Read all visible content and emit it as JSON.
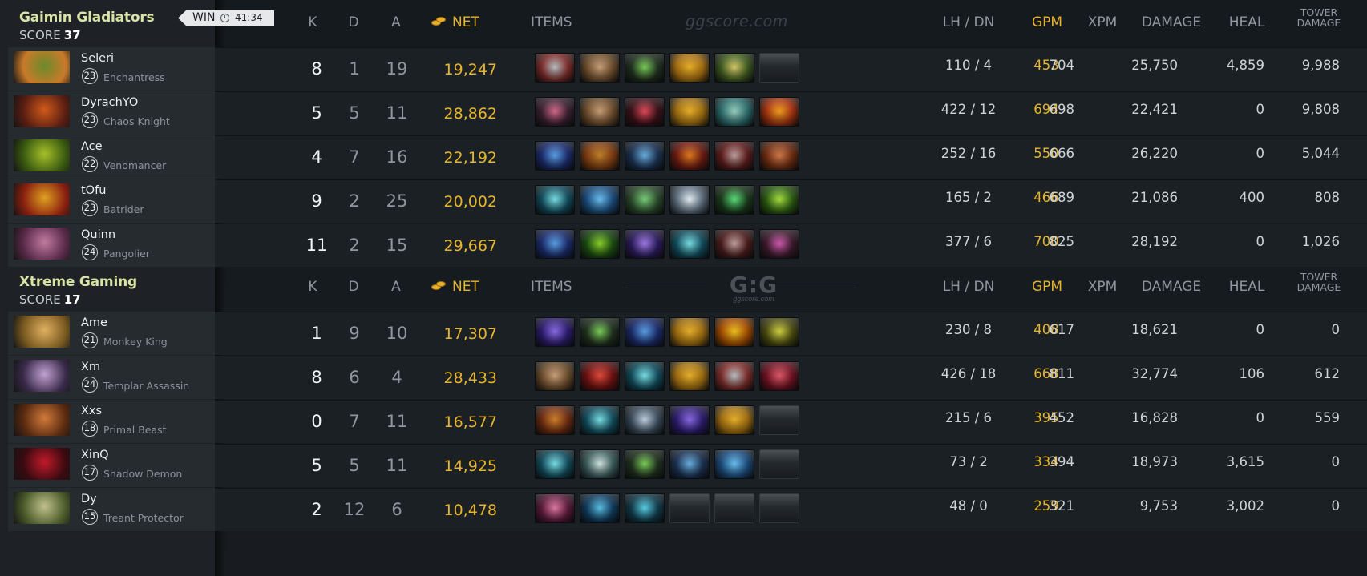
{
  "teams": [
    {
      "name": "Gaimin Gladiators",
      "score_label": "SCORE",
      "score": "37",
      "result": "WIN",
      "duration": "41:34",
      "players": [
        {
          "name": "Seleri",
          "level": "23",
          "hero": "Enchantress",
          "k": "8",
          "d": "1",
          "a": "19",
          "net": "19,247",
          "lh_dn": "110  /  4",
          "gpm": "453",
          "xpm": "704",
          "damage": "25,750",
          "heal": "4,859",
          "tower": "9,988",
          "portrait": [
            "#c97a2a",
            "#6b8a2a"
          ],
          "items": [
            [
              "#7a2a28",
              "#b8c0c4"
            ],
            [
              "#6a4a2a",
              "#c9a079"
            ],
            [
              "#20301e",
              "#7bcf5a"
            ],
            [
              "#a06a10",
              "#e8b02a"
            ],
            [
              "#3e5a1e",
              "#d6c96a"
            ],
            null
          ]
        },
        {
          "name": "DyrachYO",
          "level": "23",
          "hero": "Chaos Knight",
          "k": "5",
          "d": "5",
          "a": "11",
          "net": "28,862",
          "lh_dn": "422  /  12",
          "gpm": "694",
          "xpm": "698",
          "damage": "22,421",
          "heal": "0",
          "tower": "9,808",
          "portrait": [
            "#5a1e12",
            "#d05a1a"
          ],
          "items": [
            [
              "#3a2030",
              "#d36a8a"
            ],
            [
              "#6a4a2a",
              "#c9a079"
            ],
            [
              "#3a1018",
              "#e24a5a"
            ],
            [
              "#9a6a10",
              "#e8b02a"
            ],
            [
              "#2a6a6a",
              "#9ad0c0"
            ],
            [
              "#a03010",
              "#f0a020"
            ]
          ]
        },
        {
          "name": "Ace",
          "level": "22",
          "hero": "Venomancer",
          "k": "4",
          "d": "7",
          "a": "16",
          "net": "22,192",
          "lh_dn": "252  /  16",
          "gpm": "550",
          "xpm": "666",
          "damage": "26,220",
          "heal": "0",
          "tower": "5,044",
          "portrait": [
            "#3a5a10",
            "#a6c02a"
          ],
          "items": [
            [
              "#1a2a6a",
              "#5aa0e6"
            ],
            [
              "#7a3a10",
              "#c0802a"
            ],
            [
              "#1a3050",
              "#6ab0e0"
            ],
            [
              "#6a1a10",
              "#e07a20"
            ],
            [
              "#5a1a1a",
              "#c0a0a0"
            ],
            [
              "#6a2a10",
              "#d07a4a"
            ]
          ]
        },
        {
          "name": "tOfu",
          "level": "23",
          "hero": "Batrider",
          "k": "9",
          "d": "2",
          "a": "25",
          "net": "20,002",
          "lh_dn": "165  /  2",
          "gpm": "466",
          "xpm": "689",
          "damage": "21,086",
          "heal": "400",
          "tower": "808",
          "portrait": [
            "#8a2010",
            "#e0a020"
          ],
          "items": [
            [
              "#104a5a",
              "#7ae0e6"
            ],
            [
              "#1a4a7a",
              "#6ac0f0"
            ],
            [
              "#2a4a2a",
              "#7ad07a"
            ],
            [
              "#5a6a7a",
              "#e6f0f6"
            ],
            [
              "#1a3a1a",
              "#5ae07a"
            ],
            [
              "#2a5a10",
              "#a6e040"
            ]
          ]
        },
        {
          "name": "Quinn",
          "level": "24",
          "hero": "Pangolier",
          "k": "11",
          "d": "2",
          "a": "15",
          "net": "29,667",
          "lh_dn": "377  /  6",
          "gpm": "700",
          "xpm": "825",
          "damage": "28,192",
          "heal": "0",
          "tower": "1,026",
          "portrait": [
            "#5a2a4a",
            "#c07aa0"
          ],
          "items": [
            [
              "#1a2a6a",
              "#5aa0e6"
            ],
            [
              "#1a4a10",
              "#8ad02a"
            ],
            [
              "#2a1a5a",
              "#a07ae6"
            ],
            [
              "#104a5a",
              "#7ae0e6"
            ],
            [
              "#4a1a1a",
              "#c0a0a0"
            ],
            [
              "#3a1a2a",
              "#d05ab0"
            ]
          ]
        }
      ]
    },
    {
      "name": "Xtreme Gaming",
      "score_label": "SCORE",
      "score": "17",
      "players": [
        {
          "name": "Ame",
          "level": "21",
          "hero": "Monkey King",
          "k": "1",
          "d": "9",
          "a": "10",
          "net": "17,307",
          "lh_dn": "230  /  8",
          "gpm": "408",
          "xpm": "617",
          "damage": "18,621",
          "heal": "0",
          "tower": "0",
          "portrait": [
            "#7a5a20",
            "#e0b060"
          ],
          "items": [
            [
              "#2a1a6a",
              "#8a6ae6"
            ],
            [
              "#20301e",
              "#7bcf5a"
            ],
            [
              "#1a2a6a",
              "#5aa0e6"
            ],
            [
              "#9a6a10",
              "#e8b02a"
            ],
            [
              "#a04a00",
              "#f0c020"
            ],
            [
              "#4a4a10",
              "#d0d040"
            ]
          ]
        },
        {
          "name": "Xm",
          "level": "24",
          "hero": "Templar Assassin",
          "k": "8",
          "d": "6",
          "a": "4",
          "net": "28,433",
          "lh_dn": "426  /  18",
          "gpm": "668",
          "xpm": "811",
          "damage": "32,774",
          "heal": "106",
          "tower": "612",
          "portrait": [
            "#3a2a4a",
            "#c0a0d0"
          ],
          "items": [
            [
              "#6a4a2a",
              "#c9a079"
            ],
            [
              "#6a1010",
              "#e04a3a"
            ],
            [
              "#104a5a",
              "#7ae0e6"
            ],
            [
              "#9a6a10",
              "#e8b02a"
            ],
            [
              "#7a2a28",
              "#b8c0c4"
            ],
            [
              "#6a1020",
              "#e05a6a"
            ]
          ]
        },
        {
          "name": "Xxs",
          "level": "18",
          "hero": "Primal Beast",
          "k": "0",
          "d": "7",
          "a": "11",
          "net": "16,577",
          "lh_dn": "215  /  6",
          "gpm": "395",
          "xpm": "452",
          "damage": "16,828",
          "heal": "0",
          "tower": "559",
          "portrait": [
            "#5a2a10",
            "#d07a3a"
          ],
          "items": [
            [
              "#6a2a10",
              "#d0802a"
            ],
            [
              "#104a5a",
              "#7ae0e6"
            ],
            [
              "#3a4a5a",
              "#c0d0e0"
            ],
            [
              "#2a1a6a",
              "#8a6ae6"
            ],
            [
              "#9a6a10",
              "#e8b02a"
            ],
            null
          ]
        },
        {
          "name": "XinQ",
          "level": "17",
          "hero": "Shadow Demon",
          "k": "5",
          "d": "5",
          "a": "11",
          "net": "14,925",
          "lh_dn": "73  /  2",
          "gpm": "334",
          "xpm": "394",
          "damage": "18,973",
          "heal": "3,615",
          "tower": "0",
          "portrait": [
            "#3a0a10",
            "#c01a2a"
          ],
          "items": [
            [
              "#104a5a",
              "#7ae0e6"
            ],
            [
              "#3a5a5a",
              "#d0e6e0"
            ],
            [
              "#20301e",
              "#7bcf5a"
            ],
            [
              "#1a3050",
              "#6ab0e0"
            ],
            [
              "#1a4a7a",
              "#6ac0f0"
            ],
            null
          ]
        },
        {
          "name": "Dy",
          "level": "15",
          "hero": "Treant Protector",
          "k": "2",
          "d": "12",
          "a": "6",
          "net": "10,478",
          "lh_dn": "48  /  0",
          "gpm": "259",
          "xpm": "321",
          "damage": "9,753",
          "heal": "3,002",
          "tower": "0",
          "portrait": [
            "#4a5a2a",
            "#c0c08a"
          ],
          "items": [
            [
              "#5a1a3a",
              "#e07aa0"
            ],
            [
              "#103a5a",
              "#5ac0e6"
            ],
            [
              "#103a4a",
              "#5ad0e6"
            ],
            null,
            null,
            null
          ]
        }
      ]
    }
  ],
  "headers": {
    "k": "K",
    "d": "D",
    "a": "A",
    "net": "NET",
    "items": "ITEMS",
    "lh_dn": "LH  /  DN",
    "gpm": "GPM",
    "xpm": "XPM",
    "damage": "DAMAGE",
    "heal": "HEAL",
    "tower_line1": "TOWER",
    "tower_line2": "DAMAGE"
  },
  "watermarks": {
    "site": "ggscore.com",
    "logo": "G:G",
    "logo_sub": "ggscore.com"
  }
}
